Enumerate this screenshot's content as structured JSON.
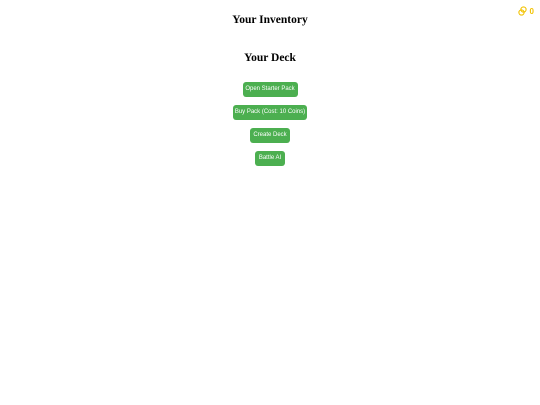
{
  "header": {
    "coin_icon": "coin-stack-icon",
    "coin_count": "0",
    "coin_color": "#f2c200"
  },
  "inventory": {
    "title": "Your Inventory"
  },
  "deck": {
    "title": "Your Deck"
  },
  "actions": {
    "open_starter_pack": "Open Starter Pack",
    "buy_pack": "Buy Pack (Cost: 10 Coins)",
    "create_deck": "Create Deck",
    "battle_ai": "Battle AI",
    "button_color": "#4caf50"
  }
}
